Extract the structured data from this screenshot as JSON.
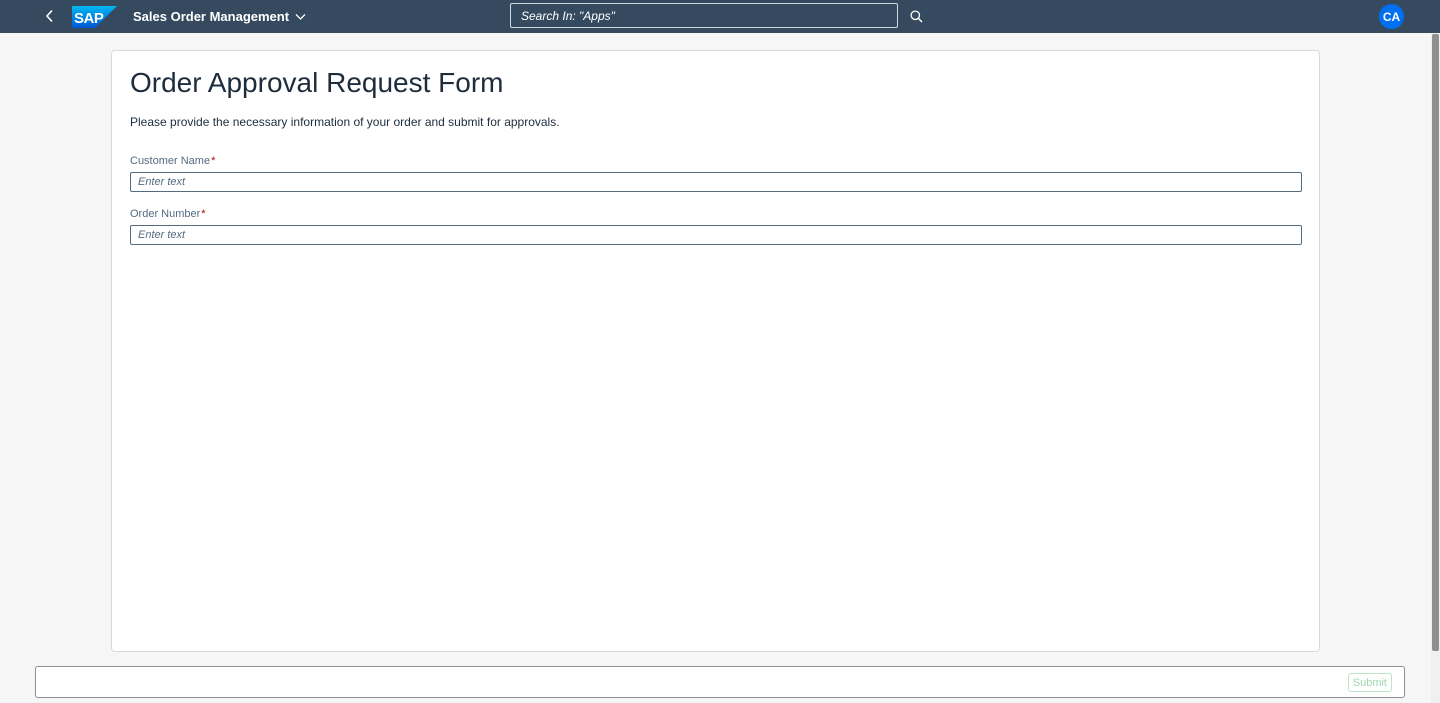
{
  "shellbar": {
    "logo_text": "SAP",
    "app_title": "Sales Order Management",
    "search_placeholder": "Search In: \"Apps\"",
    "avatar_initials": "CA",
    "colors": {
      "background": "#354a5f",
      "avatar": "#0070f2"
    },
    "icons": {
      "back": "chevron-left-icon",
      "title_menu": "chevron-down-icon",
      "search": "search-icon"
    }
  },
  "form": {
    "title": "Order Approval Request Form",
    "description": "Please provide the necessary information of your order and submit for approvals.",
    "fields": [
      {
        "label": "Customer Name",
        "required_mark": "*",
        "placeholder": "Enter text",
        "value": ""
      },
      {
        "label": "Order Number",
        "required_mark": "*",
        "placeholder": "Enter text",
        "value": ""
      }
    ]
  },
  "footer": {
    "submit_label": "Submit"
  }
}
